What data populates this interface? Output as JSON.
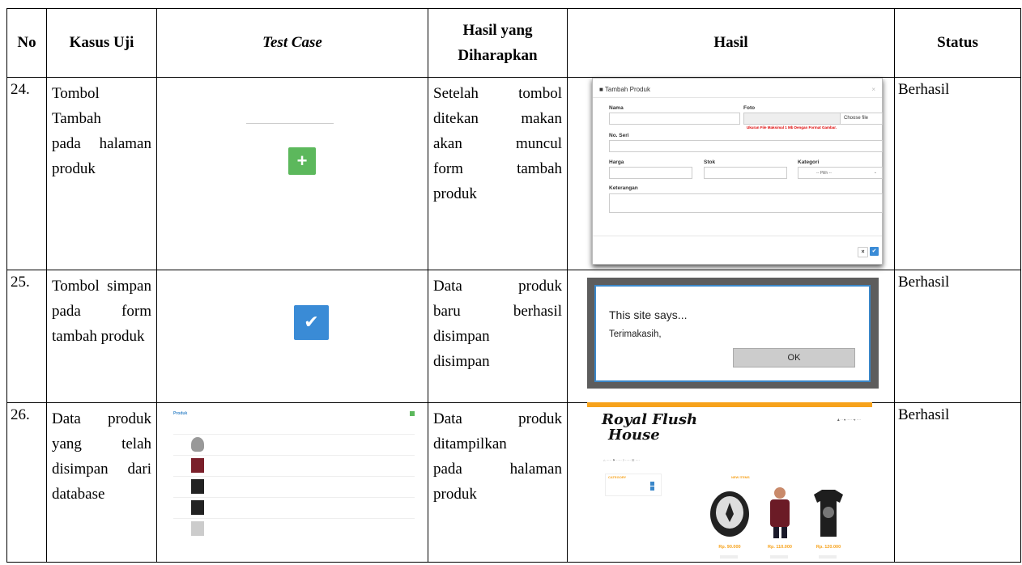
{
  "headers": {
    "no": "No",
    "kasus": "Kasus Uji",
    "test_case": "Test Case",
    "hasil_harap": "Hasil yang Diharapkan",
    "hasil": "Hasil",
    "status": "Status"
  },
  "rows": [
    {
      "no": "24.",
      "kasus": [
        "Tombol Tambah",
        "pada halaman",
        "produk"
      ],
      "harap": [
        "Setelah tombol",
        "ditekan makan",
        "akan muncul",
        "form tambah",
        "produk"
      ],
      "status": "Berhasil"
    },
    {
      "no": "25.",
      "kasus": [
        "Tombol simpan",
        "pada form",
        "tambah produk"
      ],
      "harap": [
        "Data produk",
        "baru berhasil",
        "disimpan",
        "disimpan"
      ],
      "status": "Berhasil"
    },
    {
      "no": "26.",
      "kasus": [
        "Data produk",
        "yang telah",
        "disimpan dari",
        "database"
      ],
      "harap": [
        "Data produk",
        "ditampilkan",
        "pada halaman",
        "produk"
      ],
      "status": "Berhasil"
    }
  ],
  "modal": {
    "title": "Tambah Produk",
    "close": "×",
    "nama": "Nama",
    "foto": "Foto",
    "choose": "Choose file",
    "warning": "Ukuran File Maksimal 1 Mb Dengan Format Gambar.",
    "no_seri": "No. Seri",
    "harga": "Harga",
    "stok": "Stok",
    "kategori": "Kategori",
    "pilih": "-- Pilih --",
    "keterangan": "Keterangan",
    "btn_cancel": "×",
    "btn_ok": "✔"
  },
  "dialog": {
    "title": "This site says...",
    "message": "Terimakasih,",
    "ok": "OK"
  },
  "plist": {
    "title": "Produk"
  },
  "store": {
    "logo_line1": "Royal Flush",
    "logo_line2": "House",
    "prices": [
      "Rp. 90.000",
      "Rp. 110.000",
      "Rp. 120.000"
    ],
    "kategori": "CATEGORY",
    "new_items": "NEW ITEMS"
  },
  "colors": {
    "green": "#5cb85c",
    "blue": "#3a8bd6",
    "orange": "#f7a21b"
  }
}
